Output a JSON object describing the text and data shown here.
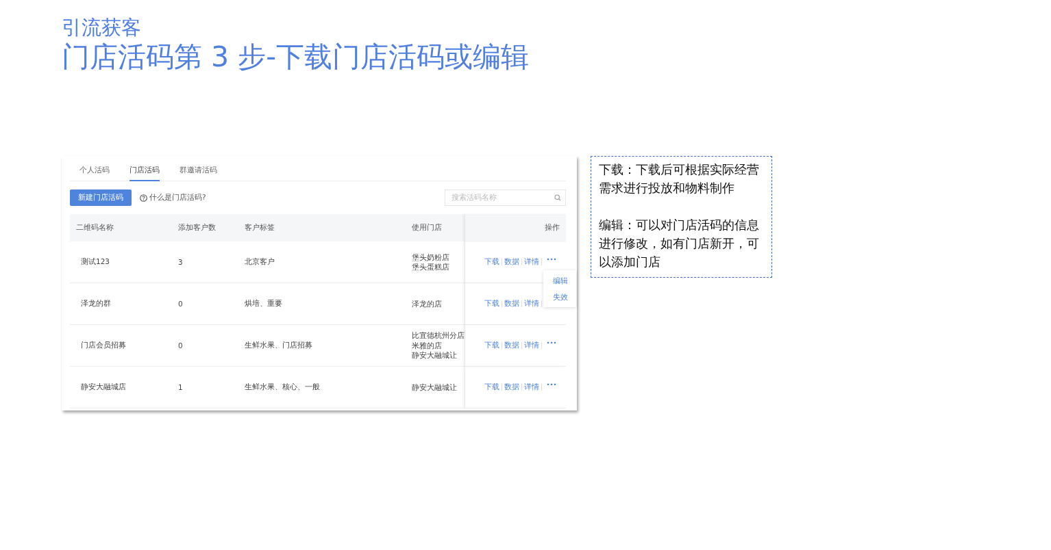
{
  "heading": {
    "section": "引流获客",
    "title": "门店活码第 3 步-下载门店活码或编辑"
  },
  "tabs": [
    {
      "label": "个人活码",
      "selected": false
    },
    {
      "label": "门店活码",
      "selected": true
    },
    {
      "label": "群邀请活码",
      "selected": false
    }
  ],
  "toolbar": {
    "create_button": "新建门店活码",
    "help_link": "什么是门店活码?",
    "search": {
      "placeholder": "搜索活码名称"
    }
  },
  "table": {
    "columns": [
      "二维码名称",
      "添加客户数",
      "客户标签",
      "使用门店",
      "操作"
    ],
    "rows": [
      {
        "name": "测试123",
        "count": "3",
        "tags": "北京客户",
        "stores": [
          "堡头奶粉店",
          "堡头蛋糕店"
        ],
        "actions": [
          "下载",
          "数据",
          "详情"
        ],
        "more": true,
        "menu_open": true
      },
      {
        "name": "泽龙的群",
        "count": "0",
        "tags": "烘培、重要",
        "stores": [
          "泽龙的店"
        ],
        "actions": [
          "下载",
          "数据",
          "详情"
        ],
        "more": false
      },
      {
        "name": "门店会员招募",
        "count": "0",
        "tags": "生鲜水果、门店招募",
        "stores": [
          "比宜德杭州分店",
          "米雅的店",
          "静安大融城让"
        ],
        "actions": [
          "下载",
          "数据",
          "详情"
        ],
        "more": true
      },
      {
        "name": "静安大融城店",
        "count": "1",
        "tags": "生鲜水果、核心、一般",
        "stores": [
          "静安大融城让"
        ],
        "actions": [
          "下载",
          "数据",
          "详情"
        ],
        "more": true
      }
    ]
  },
  "menu": {
    "items": [
      "编辑",
      "失效"
    ]
  },
  "note": {
    "paragraphs": [
      "下载：下载后可根据实际经营需求进行投放和物料制作",
      "编辑：可以对门店活码的信息进行修改，如有门店新开，可以添加门店"
    ]
  }
}
